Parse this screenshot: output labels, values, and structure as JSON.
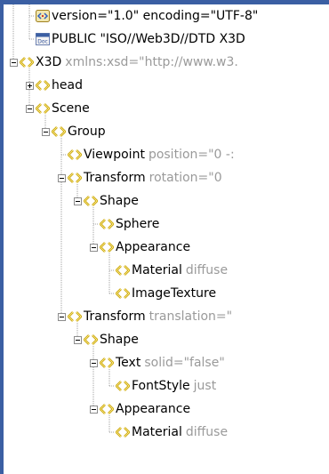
{
  "nodes": [
    {
      "icon": "xml-declaration-icon",
      "name": "version=\"1.0\" encoding=\"UTF-8\"",
      "attr": ""
    },
    {
      "icon": "doctype-icon",
      "name": "PUBLIC \"ISO//Web3D//DTD X3D",
      "attr": ""
    },
    {
      "icon": "element-icon",
      "name": "X3D",
      "attr": "xmlns:xsd=\"http://www.w3."
    },
    {
      "icon": "element-icon",
      "name": "head",
      "attr": ""
    },
    {
      "icon": "element-icon",
      "name": "Scene",
      "attr": ""
    },
    {
      "icon": "element-icon",
      "name": "Group",
      "attr": ""
    },
    {
      "icon": "element-icon",
      "name": "Viewpoint",
      "attr": "position=\"0 -:"
    },
    {
      "icon": "element-icon",
      "name": "Transform",
      "attr": "rotation=\"0"
    },
    {
      "icon": "element-icon",
      "name": "Shape",
      "attr": ""
    },
    {
      "icon": "element-icon",
      "name": "Sphere",
      "attr": ""
    },
    {
      "icon": "element-icon",
      "name": "Appearance",
      "attr": ""
    },
    {
      "icon": "element-icon",
      "name": "Material",
      "attr": "diffuse"
    },
    {
      "icon": "element-icon",
      "name": "ImageTexture",
      "attr": ""
    },
    {
      "icon": "element-icon",
      "name": "Transform",
      "attr": "translation=\""
    },
    {
      "icon": "element-icon",
      "name": "Shape",
      "attr": ""
    },
    {
      "icon": "element-icon",
      "name": "Text",
      "attr": "solid=\"false\""
    },
    {
      "icon": "element-icon",
      "name": "FontStyle",
      "attr": "just"
    },
    {
      "icon": "element-icon",
      "name": "Appearance",
      "attr": ""
    },
    {
      "icon": "element-icon",
      "name": "Material",
      "attr": "diffuse"
    }
  ]
}
